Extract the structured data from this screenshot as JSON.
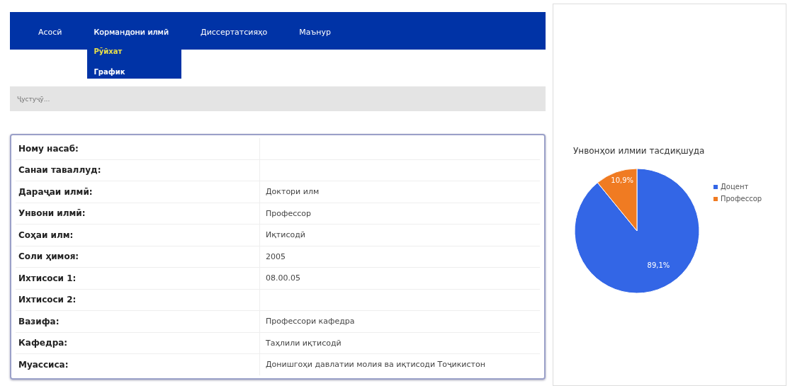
{
  "nav": {
    "items": [
      {
        "label": "Асосӣ",
        "expanded": false
      },
      {
        "label": "Кормандони илмӣ",
        "expanded": true,
        "children": [
          {
            "label": "Рӯйхат",
            "selected": true
          },
          {
            "label": "График",
            "selected": false
          }
        ]
      },
      {
        "label": "Диссертатсияҳо",
        "expanded": false
      },
      {
        "label": "Маънур",
        "expanded": false
      }
    ]
  },
  "search": {
    "placeholder": "Ҷустуҷӯ..."
  },
  "details": [
    {
      "label": "Ному насаб:"
    },
    {
      "label": "Санаи таваллуд:"
    },
    {
      "label": "Дараҷаи илмӣ:",
      "value": "Доктори илм"
    },
    {
      "label": "Унвони илмӣ:",
      "value": "Профессор"
    },
    {
      "label": "Соҳаи илм:",
      "value": "Иқтисодӣ"
    },
    {
      "label": "Соли ҳимоя:",
      "value": "2005"
    },
    {
      "label": "Ихтисоси 1:",
      "value": "08.00.05"
    },
    {
      "label": "Ихтисоси 2:"
    },
    {
      "label": "Вазифа:",
      "value": "Профессори кафедра"
    },
    {
      "label": "Кафедра:",
      "value": "Таҳлили иқтисодӣ"
    },
    {
      "label": "Муассиса:",
      "value": "Донишгоҳи давлатии молия ва иқтисоди Тоҷикистон"
    }
  ],
  "chart_panel": {
    "chart_data": {
      "type": "pie",
      "title": "Унвонҳои илмии тасдиқшуда",
      "categories": [
        "Доцент",
        "Профессор"
      ],
      "values": [
        89.1,
        10.9
      ],
      "value_labels": [
        "89,1%",
        "10,9%"
      ],
      "legend": true
    }
  }
}
